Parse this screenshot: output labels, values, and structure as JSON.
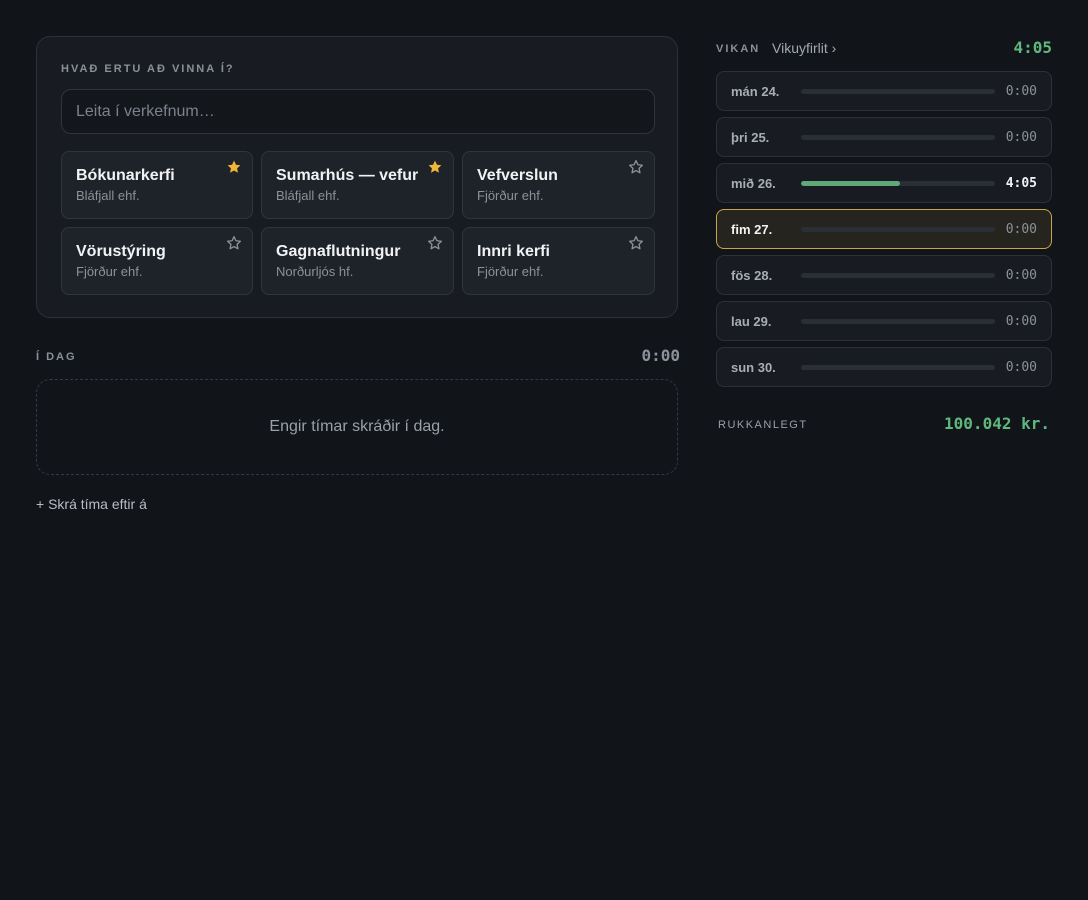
{
  "picker": {
    "heading": "HVAÐ ERTU AÐ VINNA Í?",
    "search_placeholder": "Leita í verkefnum…",
    "projects": [
      {
        "name": "Bókunarkerfi",
        "client": "Bláfjall ehf.",
        "starred": true
      },
      {
        "name": "Sumarhús — vefur",
        "client": "Bláfjall ehf.",
        "starred": true
      },
      {
        "name": "Vefverslun",
        "client": "Fjörður ehf.",
        "starred": false
      },
      {
        "name": "Vörustýring",
        "client": "Fjörður ehf.",
        "starred": false
      },
      {
        "name": "Gagnaflutningur",
        "client": "Norðurljós hf.",
        "starred": false
      },
      {
        "name": "Innri kerfi",
        "client": "Fjörður ehf.",
        "starred": false
      }
    ]
  },
  "today": {
    "heading": "Í DAG",
    "total": "0:00",
    "empty_text": "Engir tímar skráðir í dag.",
    "add_later_label": "+ Skrá tíma eftir á"
  },
  "week": {
    "heading": "VIKAN",
    "overview_link": "Vikuyfirlit ›",
    "total": "4:05",
    "days": [
      {
        "label": "mán 24.",
        "time": "0:00",
        "progress": 0,
        "today": false
      },
      {
        "label": "þri 25.",
        "time": "0:00",
        "progress": 0,
        "today": false
      },
      {
        "label": "mið 26.",
        "time": "4:05",
        "progress": 0.51,
        "today": false
      },
      {
        "label": "fim 27.",
        "time": "0:00",
        "progress": 0,
        "today": true
      },
      {
        "label": "fös 28.",
        "time": "0:00",
        "progress": 0,
        "today": false
      },
      {
        "label": "lau 29.",
        "time": "0:00",
        "progress": 0,
        "today": false
      },
      {
        "label": "sun 30.",
        "time": "0:00",
        "progress": 0,
        "today": false
      }
    ],
    "billable_label": "RUKKANLEGT",
    "billable_value": "100.042 kr."
  },
  "colors": {
    "accent_green": "#5fb87d",
    "star_active": "#f2b53a",
    "today_border": "#c9a44a"
  }
}
